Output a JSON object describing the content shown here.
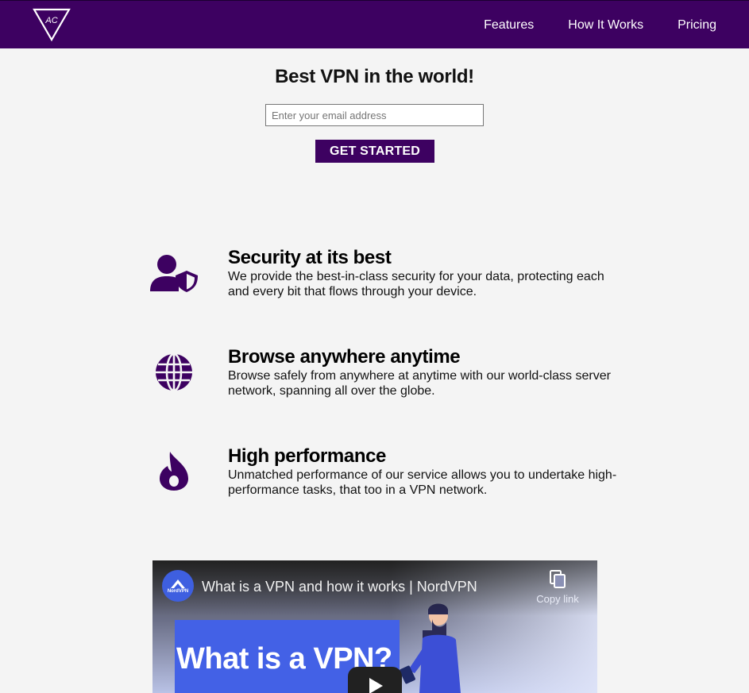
{
  "header": {
    "logo_text": "AC",
    "nav": [
      "Features",
      "How It Works",
      "Pricing"
    ],
    "colors": {
      "brand": "#3d0161"
    }
  },
  "hero": {
    "title": "Best VPN in the world!",
    "email_placeholder": "Enter your email address",
    "cta_label": "GET STARTED"
  },
  "features": [
    {
      "icon": "user-shield-icon",
      "title": "Security at its best",
      "text": "We provide the best-in-class security for your data, protecting each and every bit that flows through your device."
    },
    {
      "icon": "globe-icon",
      "title": "Browse anywhere anytime",
      "text": "Browse safely from anywhere at anytime with our world-class server network, spanning all over the globe."
    },
    {
      "icon": "fire-icon",
      "title": "High performance",
      "text": "Unmatched performance of our service allows you to undertake high-performance tasks, that too in a VPN network."
    }
  ],
  "video": {
    "channel": "NordVPN",
    "title": "What is a VPN and how it works | NordVPN",
    "copy_link": "Copy link",
    "frame_text": "What is a VPN?"
  }
}
